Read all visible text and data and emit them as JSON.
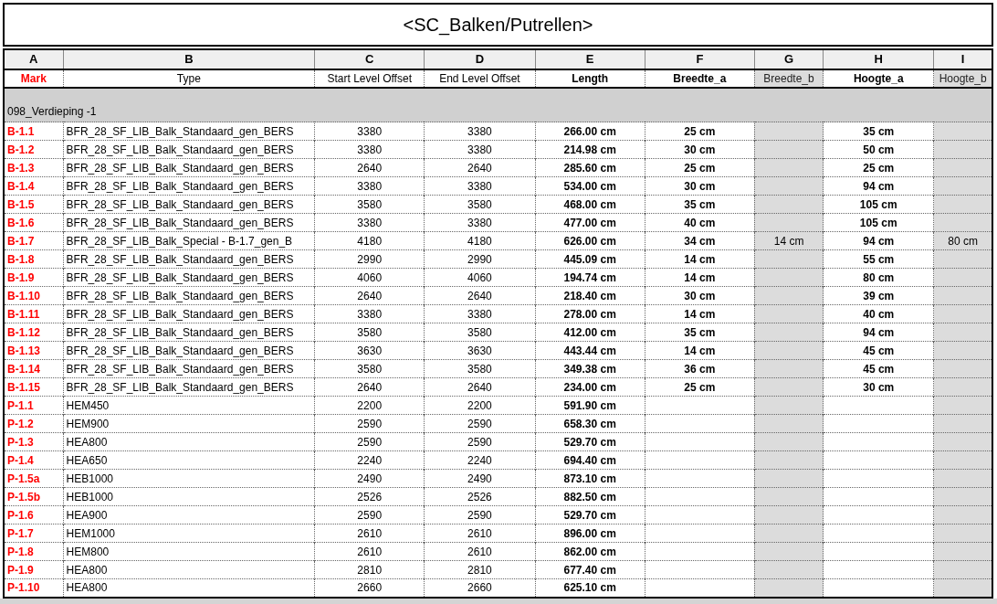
{
  "title": "<SC_Balken/Putrellen>",
  "columns": [
    {
      "letter": "A",
      "label": "Mark",
      "bold": true,
      "disabled": false,
      "color": "#ff0000"
    },
    {
      "letter": "B",
      "label": "Type",
      "bold": false,
      "disabled": false
    },
    {
      "letter": "C",
      "label": "Start Level Offset",
      "bold": false,
      "disabled": false
    },
    {
      "letter": "D",
      "label": "End Level Offset",
      "bold": false,
      "disabled": false
    },
    {
      "letter": "E",
      "label": "Length",
      "bold": true,
      "disabled": false
    },
    {
      "letter": "F",
      "label": "Breedte_a",
      "bold": true,
      "disabled": false
    },
    {
      "letter": "G",
      "label": "Breedte_b",
      "bold": false,
      "disabled": true
    },
    {
      "letter": "H",
      "label": "Hoogte_a",
      "bold": true,
      "disabled": false
    },
    {
      "letter": "I",
      "label": "Hoogte_b",
      "bold": false,
      "disabled": true
    }
  ],
  "group": "098_Verdieping -1",
  "rows": [
    [
      "B-1.1",
      "BFR_28_SF_LIB_Balk_Standaard_gen_BERS",
      "3380",
      "3380",
      "266.00 cm",
      "25 cm",
      null,
      "35 cm",
      null
    ],
    [
      "B-1.2",
      "BFR_28_SF_LIB_Balk_Standaard_gen_BERS",
      "3380",
      "3380",
      "214.98 cm",
      "30 cm",
      null,
      "50 cm",
      null
    ],
    [
      "B-1.3",
      "BFR_28_SF_LIB_Balk_Standaard_gen_BERS",
      "2640",
      "2640",
      "285.60 cm",
      "25 cm",
      null,
      "25 cm",
      null
    ],
    [
      "B-1.4",
      "BFR_28_SF_LIB_Balk_Standaard_gen_BERS",
      "3380",
      "3380",
      "534.00 cm",
      "30 cm",
      null,
      "94 cm",
      null
    ],
    [
      "B-1.5",
      "BFR_28_SF_LIB_Balk_Standaard_gen_BERS",
      "3580",
      "3580",
      "468.00 cm",
      "35 cm",
      null,
      "105 cm",
      null
    ],
    [
      "B-1.6",
      "BFR_28_SF_LIB_Balk_Standaard_gen_BERS",
      "3380",
      "3380",
      "477.00 cm",
      "40 cm",
      null,
      "105 cm",
      null
    ],
    [
      "B-1.7",
      "BFR_28_SF_LIB_Balk_Special - B-1.7_gen_B",
      "4180",
      "4180",
      "626.00 cm",
      "34 cm",
      "14 cm",
      "94 cm",
      "80 cm"
    ],
    [
      "B-1.8",
      "BFR_28_SF_LIB_Balk_Standaard_gen_BERS",
      "2990",
      "2990",
      "445.09 cm",
      "14 cm",
      null,
      "55 cm",
      null
    ],
    [
      "B-1.9",
      "BFR_28_SF_LIB_Balk_Standaard_gen_BERS",
      "4060",
      "4060",
      "194.74 cm",
      "14 cm",
      null,
      "80 cm",
      null
    ],
    [
      "B-1.10",
      "BFR_28_SF_LIB_Balk_Standaard_gen_BERS",
      "2640",
      "2640",
      "218.40 cm",
      "30 cm",
      null,
      "39 cm",
      null
    ],
    [
      "B-1.11",
      "BFR_28_SF_LIB_Balk_Standaard_gen_BERS",
      "3380",
      "3380",
      "278.00 cm",
      "14 cm",
      null,
      "40 cm",
      null
    ],
    [
      "B-1.12",
      "BFR_28_SF_LIB_Balk_Standaard_gen_BERS",
      "3580",
      "3580",
      "412.00 cm",
      "35 cm",
      null,
      "94 cm",
      null
    ],
    [
      "B-1.13",
      "BFR_28_SF_LIB_Balk_Standaard_gen_BERS",
      "3630",
      "3630",
      "443.44 cm",
      "14 cm",
      null,
      "45 cm",
      null
    ],
    [
      "B-1.14",
      "BFR_28_SF_LIB_Balk_Standaard_gen_BERS",
      "3580",
      "3580",
      "349.38 cm",
      "36 cm",
      null,
      "45 cm",
      null
    ],
    [
      "B-1.15",
      "BFR_28_SF_LIB_Balk_Standaard_gen_BERS",
      "2640",
      "2640",
      "234.00 cm",
      "25 cm",
      null,
      "30 cm",
      null
    ],
    [
      "P-1.1",
      "HEM450",
      "2200",
      "2200",
      "591.90 cm",
      null,
      null,
      null,
      null
    ],
    [
      "P-1.2",
      "HEM900",
      "2590",
      "2590",
      "658.30 cm",
      null,
      null,
      null,
      null
    ],
    [
      "P-1.3",
      "HEA800",
      "2590",
      "2590",
      "529.70 cm",
      null,
      null,
      null,
      null
    ],
    [
      "P-1.4",
      "HEA650",
      "2240",
      "2240",
      "694.40 cm",
      null,
      null,
      null,
      null
    ],
    [
      "P-1.5a",
      "HEB1000",
      "2490",
      "2490",
      "873.10 cm",
      null,
      null,
      null,
      null
    ],
    [
      "P-1.5b",
      "HEB1000",
      "2526",
      "2526",
      "882.50 cm",
      null,
      null,
      null,
      null
    ],
    [
      "P-1.6",
      "HEA900",
      "2590",
      "2590",
      "529.70 cm",
      null,
      null,
      null,
      null
    ],
    [
      "P-1.7",
      "HEM1000",
      "2610",
      "2610",
      "896.00 cm",
      null,
      null,
      null,
      null
    ],
    [
      "P-1.8",
      "HEM800",
      "2610",
      "2610",
      "862.00 cm",
      null,
      null,
      null,
      null
    ],
    [
      "P-1.9",
      "HEA800",
      "2810",
      "2810",
      "677.40 cm",
      null,
      null,
      null,
      null
    ],
    [
      "P-1.10",
      "HEA800",
      "2660",
      "2660",
      "625.10 cm",
      null,
      null,
      null,
      null
    ]
  ]
}
